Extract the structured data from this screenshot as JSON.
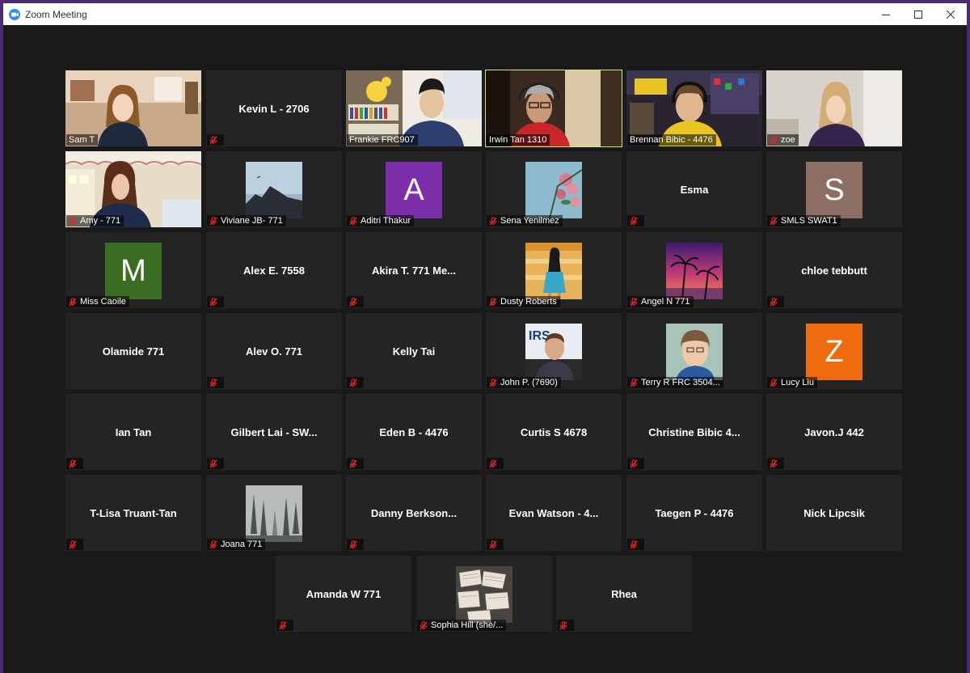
{
  "window": {
    "title": "Zoom Meeting",
    "controls": [
      "minimize",
      "maximize",
      "close"
    ]
  },
  "participants": [
    {
      "name": "Sam T",
      "view": "video",
      "muted": false,
      "label": "Sam T"
    },
    {
      "name": "Kevin L - 2706",
      "view": "name",
      "muted": true
    },
    {
      "name": "Frankie FRC907",
      "view": "video",
      "muted": false,
      "label": "Frankie FRC907"
    },
    {
      "name": "Irwin Tan 1310",
      "view": "video",
      "muted": false,
      "label": "Irwin Tan 1310",
      "active": true
    },
    {
      "name": "Brennan Bibic - 4476",
      "view": "video",
      "muted": false,
      "label": "Brennan Bibic - 4476"
    },
    {
      "name": "zoe",
      "view": "video",
      "muted": true,
      "label": "zoe"
    },
    {
      "name": "Amy - 771",
      "view": "video",
      "muted": true,
      "label": "Amy - 771"
    },
    {
      "name": "Viviane JB- 771",
      "view": "picture",
      "muted": true,
      "label": "Viviane JB- 771"
    },
    {
      "name": "Aditri Thakur",
      "view": "initial",
      "initial": "A",
      "color": "#7b2fa8",
      "muted": true,
      "label": "Aditri Thakur"
    },
    {
      "name": "Sena Yenilmez",
      "view": "picture",
      "muted": true,
      "label": "Sena Yenilmez"
    },
    {
      "name": "Esma",
      "view": "name",
      "muted": true
    },
    {
      "name": "SMLS SWAT1",
      "view": "initial",
      "initial": "S",
      "color": "#8d6e63",
      "muted": true,
      "label": "SMLS SWAT1"
    },
    {
      "name": "Miss Caoile",
      "view": "initial",
      "initial": "M",
      "color": "#3a6f23",
      "muted": true,
      "label": "Miss Caoile"
    },
    {
      "name": "Alex E. 7558",
      "view": "name",
      "muted": true
    },
    {
      "name": "Akira T. 771 Me...",
      "view": "name",
      "muted": true
    },
    {
      "name": "Dusty Roberts",
      "view": "picture",
      "muted": true,
      "label": "Dusty Roberts"
    },
    {
      "name": "Angel N 771",
      "view": "picture",
      "muted": true,
      "label": "Angel N 771"
    },
    {
      "name": "chloe tebbutt",
      "view": "name",
      "muted": true
    },
    {
      "name": "Olamide 771",
      "view": "name",
      "muted": false
    },
    {
      "name": "Alev O. 771",
      "view": "name",
      "muted": true
    },
    {
      "name": "Kelly Tai",
      "view": "name",
      "muted": true
    },
    {
      "name": "John P. (7690)",
      "view": "picture",
      "muted": true,
      "label": "John P. (7690)"
    },
    {
      "name": "Terry R FRC 3504...",
      "view": "picture",
      "muted": true,
      "label": "Terry R FRC 3504..."
    },
    {
      "name": "Lucy Liu",
      "view": "initial",
      "initial": "Z",
      "color": "#ee6c0f",
      "muted": true,
      "label": "Lucy Liu"
    },
    {
      "name": "Ian Tan",
      "view": "name",
      "muted": true
    },
    {
      "name": "Gilbert Lai - SW...",
      "view": "name",
      "muted": true
    },
    {
      "name": "Eden B - 4476",
      "view": "name",
      "muted": true
    },
    {
      "name": "Curtis S 4678",
      "view": "name",
      "muted": true
    },
    {
      "name": "Christine Bibic 4...",
      "view": "name",
      "muted": true
    },
    {
      "name": "Javon.J 442",
      "view": "name",
      "muted": true
    },
    {
      "name": "T-Lisa Truant-Tan",
      "view": "name",
      "muted": true
    },
    {
      "name": "Joana 771",
      "view": "picture",
      "muted": true,
      "label": "Joana 771"
    },
    {
      "name": "Danny  Berkson...",
      "view": "name",
      "muted": true
    },
    {
      "name": "Evan Watson - 4...",
      "view": "name",
      "muted": true
    },
    {
      "name": "Taegen P - 4476",
      "view": "name",
      "muted": true
    },
    {
      "name": "Nick Lipcsik",
      "view": "name",
      "muted": false
    },
    {
      "name": "Amanda W 771",
      "view": "name",
      "muted": true
    },
    {
      "name": "Sophia Hill (she/...",
      "view": "picture",
      "muted": true,
      "label": "Sophia Hill (she/..."
    },
    {
      "name": "Rhea",
      "view": "name",
      "muted": true
    }
  ]
}
